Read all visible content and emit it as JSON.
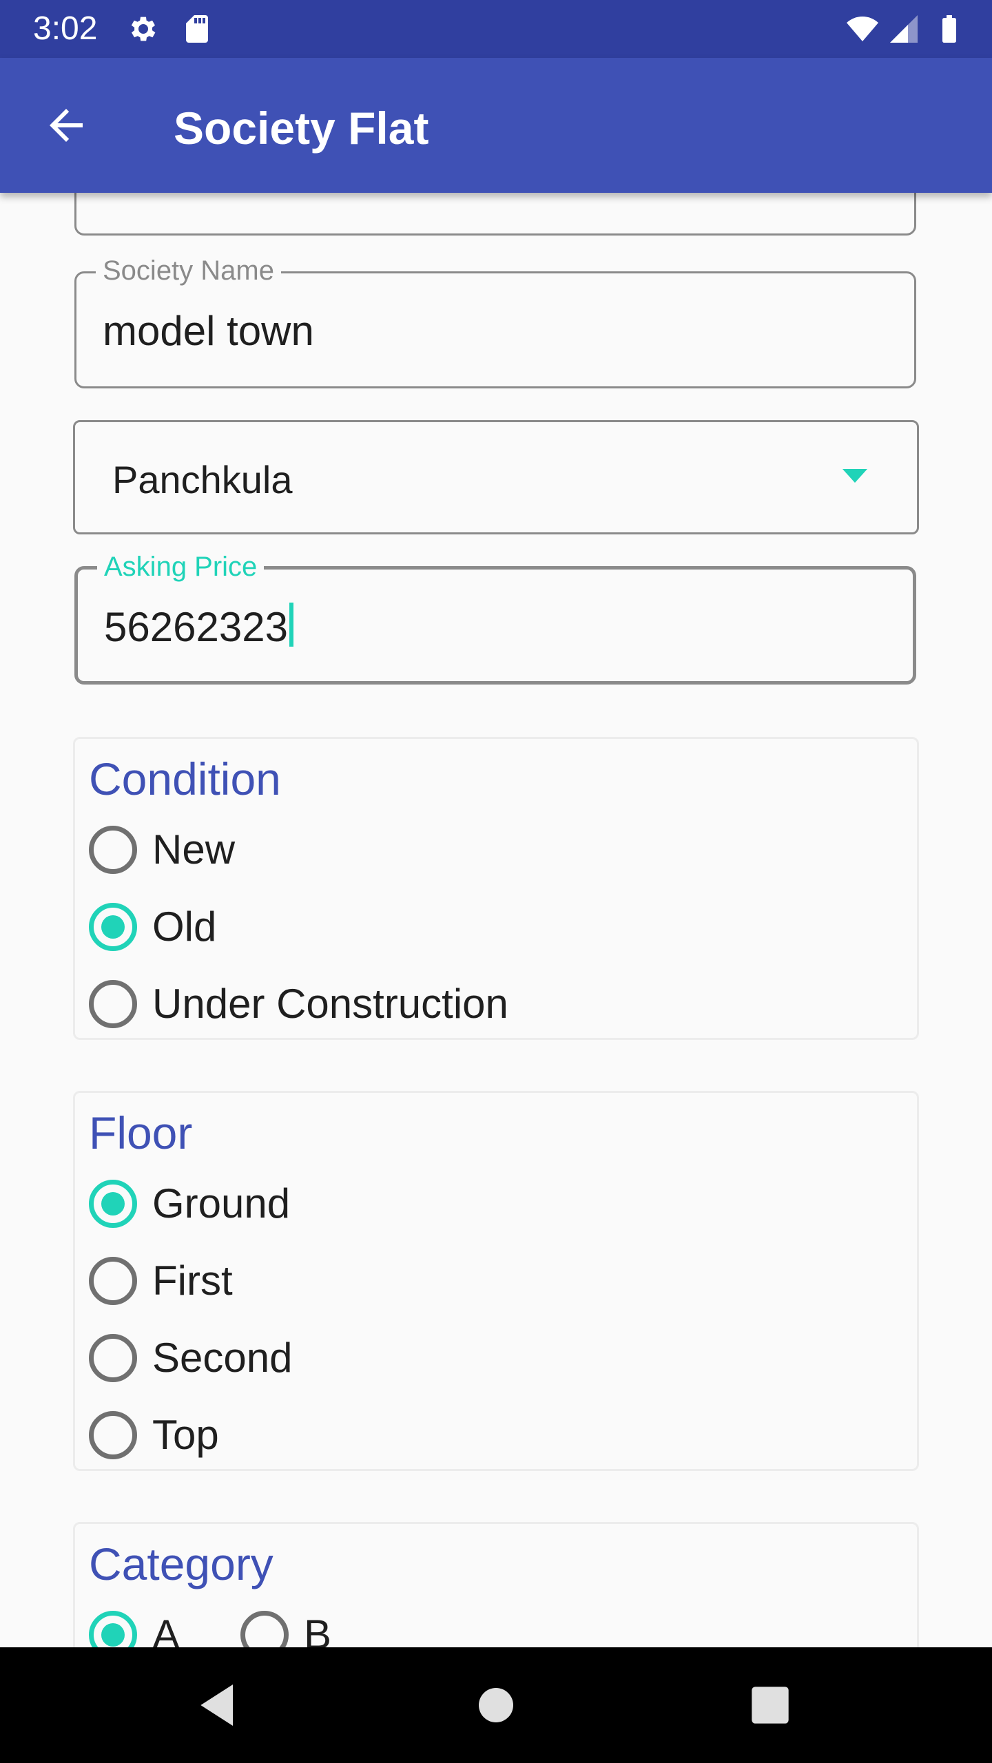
{
  "status_bar": {
    "time": "3:02",
    "icons": [
      "gear-icon",
      "sd-card-icon",
      "wifi-icon",
      "signal-icon",
      "battery-icon"
    ]
  },
  "app_bar": {
    "title": "Society Flat",
    "back_icon": "arrow-back-icon"
  },
  "form": {
    "society_name": {
      "label": "Society Name",
      "value": "model town"
    },
    "city_dropdown": {
      "selected": "Panchkula"
    },
    "asking_price": {
      "label": "Asking Price",
      "value": "56262323"
    },
    "condition": {
      "title": "Condition",
      "options": [
        "New",
        "Old",
        "Under Construction"
      ],
      "selected": "Old"
    },
    "floor": {
      "title": "Floor",
      "options": [
        "Ground",
        "First",
        "Second",
        "Top"
      ],
      "selected": "Ground"
    },
    "category": {
      "title": "Category",
      "options": [
        "A",
        "B"
      ],
      "selected": "A"
    }
  },
  "colors": {
    "status_bar": "#303f9f",
    "app_bar": "#3f51b5",
    "accent": "#20d3b8",
    "group_title": "#3f51b5"
  },
  "nav_bar": {
    "buttons": [
      "back-triangle-icon",
      "home-circle-icon",
      "recents-square-icon"
    ]
  }
}
